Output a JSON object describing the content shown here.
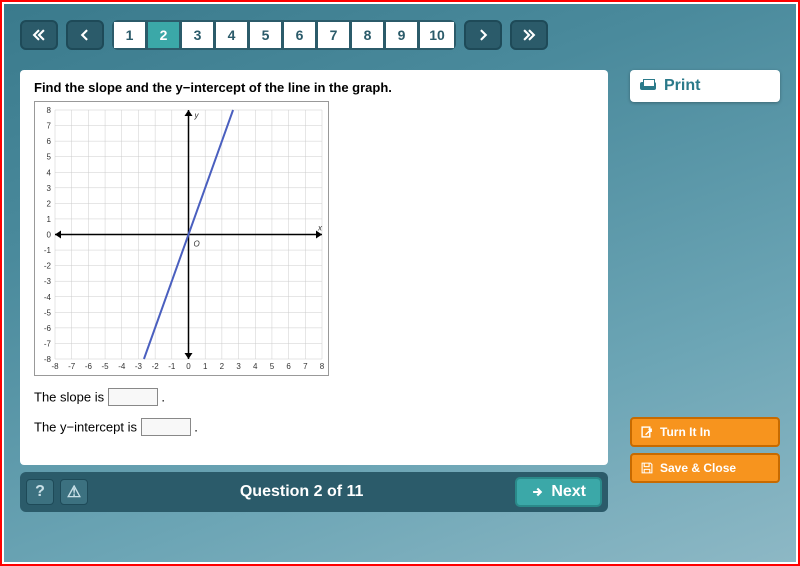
{
  "nav": {
    "pages": [
      "1",
      "2",
      "3",
      "4",
      "5",
      "6",
      "7",
      "8",
      "9",
      "10"
    ],
    "active_index": 1
  },
  "print": {
    "label": "Print"
  },
  "question": {
    "prompt_html": "Find the slope and the y−intercept of the line in the graph.",
    "slope_label_pre": "The slope is ",
    "slope_label_post": ".",
    "yint_label_pre": "The y−intercept is ",
    "yint_label_post": ".",
    "slope_value": "",
    "yint_value": ""
  },
  "side": {
    "turn_in": "Turn It In",
    "save_close": "Save & Close"
  },
  "footer": {
    "help": "?",
    "warn": "⚠",
    "progress": "Question 2 of 11",
    "next": "Next"
  },
  "chart_data": {
    "type": "line",
    "title": "",
    "xlabel": "x",
    "ylabel": "y",
    "origin_label": "O",
    "xlim": [
      -8,
      8
    ],
    "ylim": [
      -8,
      8
    ],
    "x_ticks": [
      -8,
      -7,
      -6,
      -5,
      -4,
      -3,
      -2,
      -1,
      0,
      1,
      2,
      3,
      4,
      5,
      6,
      7,
      8
    ],
    "y_ticks": [
      -8,
      -7,
      -6,
      -5,
      -4,
      -3,
      -2,
      -1,
      0,
      1,
      2,
      3,
      4,
      5,
      6,
      7,
      8
    ],
    "grid": true,
    "series": [
      {
        "name": "line",
        "color": "#4a5fbf",
        "points": [
          [
            -2.67,
            -8
          ],
          [
            2.67,
            8
          ]
        ],
        "slope": 3,
        "y_intercept": 0
      }
    ]
  }
}
